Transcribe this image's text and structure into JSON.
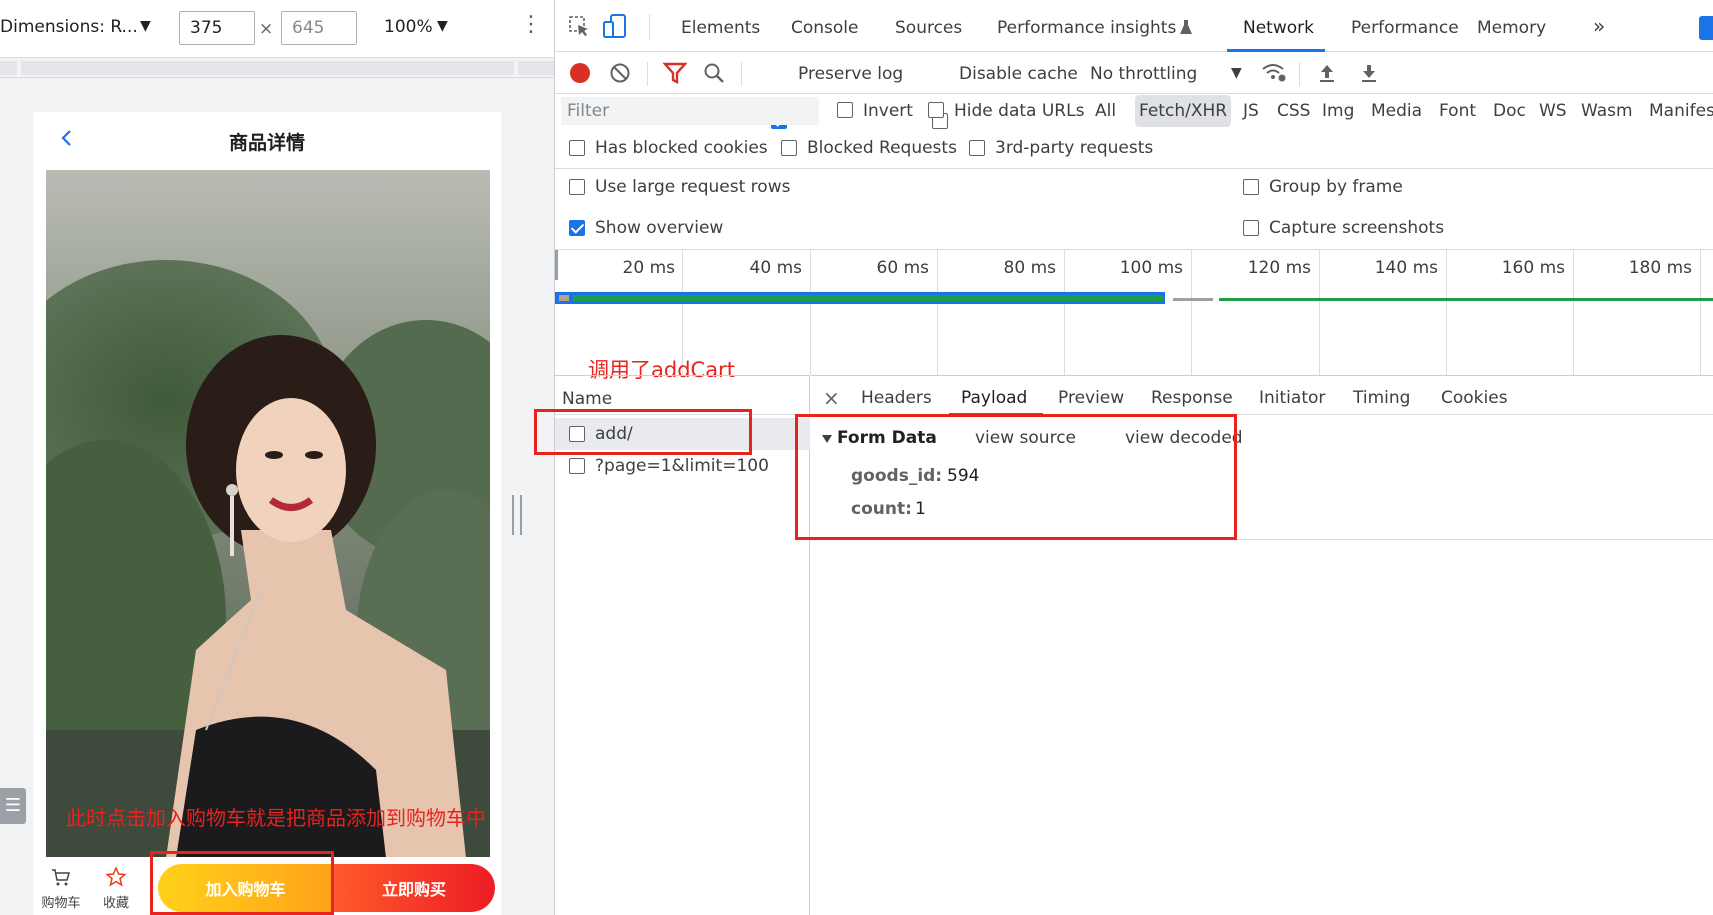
{
  "device_toolbar": {
    "dimensions_label": "Dimensions: R...",
    "width_value": "375",
    "height_placeholder": "645",
    "times": "×",
    "zoom": "100%",
    "caret": "▼",
    "kebab": "⋮"
  },
  "phone": {
    "page_title": "商品详情",
    "bottom_bar": {
      "cart_label": "购物车",
      "favorite_label": "收藏",
      "add_to_cart": "加入购物车",
      "buy_now": "立即购买"
    }
  },
  "annotations": {
    "left_note": "此时点击加入购物车就是把商品添加到购物车中",
    "network_note": "调用了addCart"
  },
  "devtools": {
    "tabs": [
      "Elements",
      "Console",
      "Sources",
      "Performance insights",
      "Network",
      "Performance",
      "Memory"
    ],
    "more_tabs": "»",
    "toolbar": {
      "preserve_log": "Preserve log",
      "disable_cache": "Disable cache",
      "throttling": "No throttling",
      "throttle_caret": "▼"
    },
    "filter": {
      "placeholder": "Filter",
      "invert": "Invert",
      "hide_data_urls": "Hide data URLs",
      "types": [
        "All",
        "Fetch/XHR",
        "JS",
        "CSS",
        "Img",
        "Media",
        "Font",
        "Doc",
        "WS",
        "Wasm",
        "Manifes"
      ]
    },
    "request_filters": {
      "blocked_cookies": "Has blocked cookies",
      "blocked_requests": "Blocked Requests",
      "third_party": "3rd-party requests"
    },
    "settings": {
      "large_rows": "Use large request rows",
      "group_by_frame": "Group by frame",
      "show_overview": "Show overview",
      "capture_screenshots": "Capture screenshots"
    },
    "overview": {
      "ticks": [
        "20 ms",
        "40 ms",
        "60 ms",
        "80 ms",
        "100 ms",
        "120 ms",
        "140 ms",
        "160 ms",
        "180 ms"
      ]
    },
    "request_list": {
      "header": "Name",
      "rows": [
        "add/",
        "?page=1&limit=100"
      ]
    },
    "detail": {
      "close": "×",
      "tabs": [
        "Headers",
        "Payload",
        "Preview",
        "Response",
        "Initiator",
        "Timing",
        "Cookies"
      ],
      "form_data_title": "Form Data",
      "view_source": "view source",
      "view_decoded": "view decoded",
      "fields": [
        {
          "key": "goods_id:",
          "value": "594"
        },
        {
          "key": "count:",
          "value": "1"
        }
      ]
    }
  },
  "colors": {
    "accent_blue": "#1a73e8",
    "record_red": "#d93025",
    "annotation_red": "#e8231f",
    "waterfall_green": "#1e9e4a"
  }
}
